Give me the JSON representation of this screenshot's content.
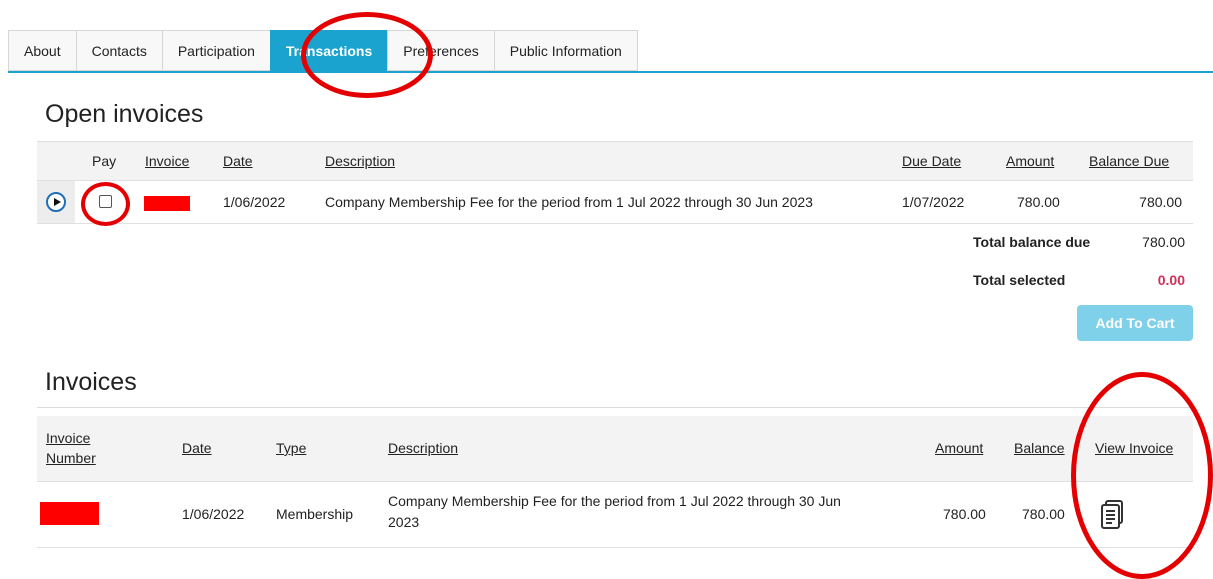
{
  "tabs": [
    {
      "label": "About"
    },
    {
      "label": "Contacts"
    },
    {
      "label": "Participation"
    },
    {
      "label": "Transactions",
      "active": true
    },
    {
      "label": "Preferences"
    },
    {
      "label": "Public Information"
    }
  ],
  "open_invoices": {
    "title": "Open invoices",
    "headers": {
      "pay": "Pay",
      "invoice": "Invoice",
      "date": "Date",
      "description": "Description",
      "due_date": "Due Date",
      "amount": "Amount",
      "balance_due": "Balance Due"
    },
    "rows": [
      {
        "pay_checked": false,
        "invoice": "",
        "date": "1/06/2022",
        "description": "Company Membership Fee for the period from 1 Jul 2022 through 30 Jun 2023",
        "due_date": "1/07/2022",
        "amount": "780.00",
        "balance_due": "780.00"
      }
    ],
    "total_balance_due_label": "Total balance due",
    "total_balance_due": "780.00",
    "total_selected_label": "Total selected",
    "total_selected": "0.00",
    "add_to_cart_label": "Add To Cart"
  },
  "invoices": {
    "title": "Invoices",
    "headers": {
      "invoice_number_line1": "Invoice",
      "invoice_number_line2": "Number",
      "date": "Date",
      "type": "Type",
      "description": "Description",
      "amount": "Amount",
      "balance": "Balance",
      "view_invoice": "View Invoice"
    },
    "rows": [
      {
        "invoice_number": "",
        "date": "1/06/2022",
        "type": "Membership",
        "description_line1": "Company Membership Fee for the period from 1 Jul 2022 through 30 Jun",
        "description_line2": "2023",
        "amount": "780.00",
        "balance": "780.00",
        "view_icon": "document-icon"
      }
    ]
  },
  "colors": {
    "accent": "#1aa3cf",
    "annotation": "#e40000",
    "redaction": "#ff0000",
    "total_selected": "#d0305a",
    "add_to_cart_bg": "#7fd1ea"
  }
}
